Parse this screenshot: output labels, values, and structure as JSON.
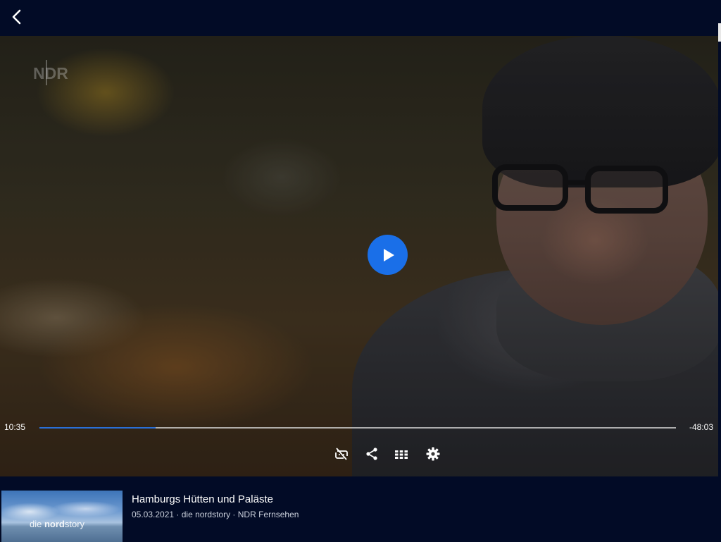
{
  "video": {
    "watermark": "NDR",
    "time_elapsed": "10:35",
    "time_remaining": "-48:03",
    "progress_fraction": 0.182,
    "accent_color": "#1a6fe8",
    "controls": [
      {
        "icon": "subtitles-off-icon"
      },
      {
        "icon": "share-icon"
      },
      {
        "icon": "grid-icon"
      },
      {
        "icon": "gear-icon"
      }
    ]
  },
  "info": {
    "thumbnail_text_light": "die ",
    "thumbnail_text_bold": "nord",
    "thumbnail_text_end": "story",
    "title": "Hamburgs Hütten und Paläste",
    "meta": "05.03.2021 · die nordstory · NDR Fernsehen"
  }
}
